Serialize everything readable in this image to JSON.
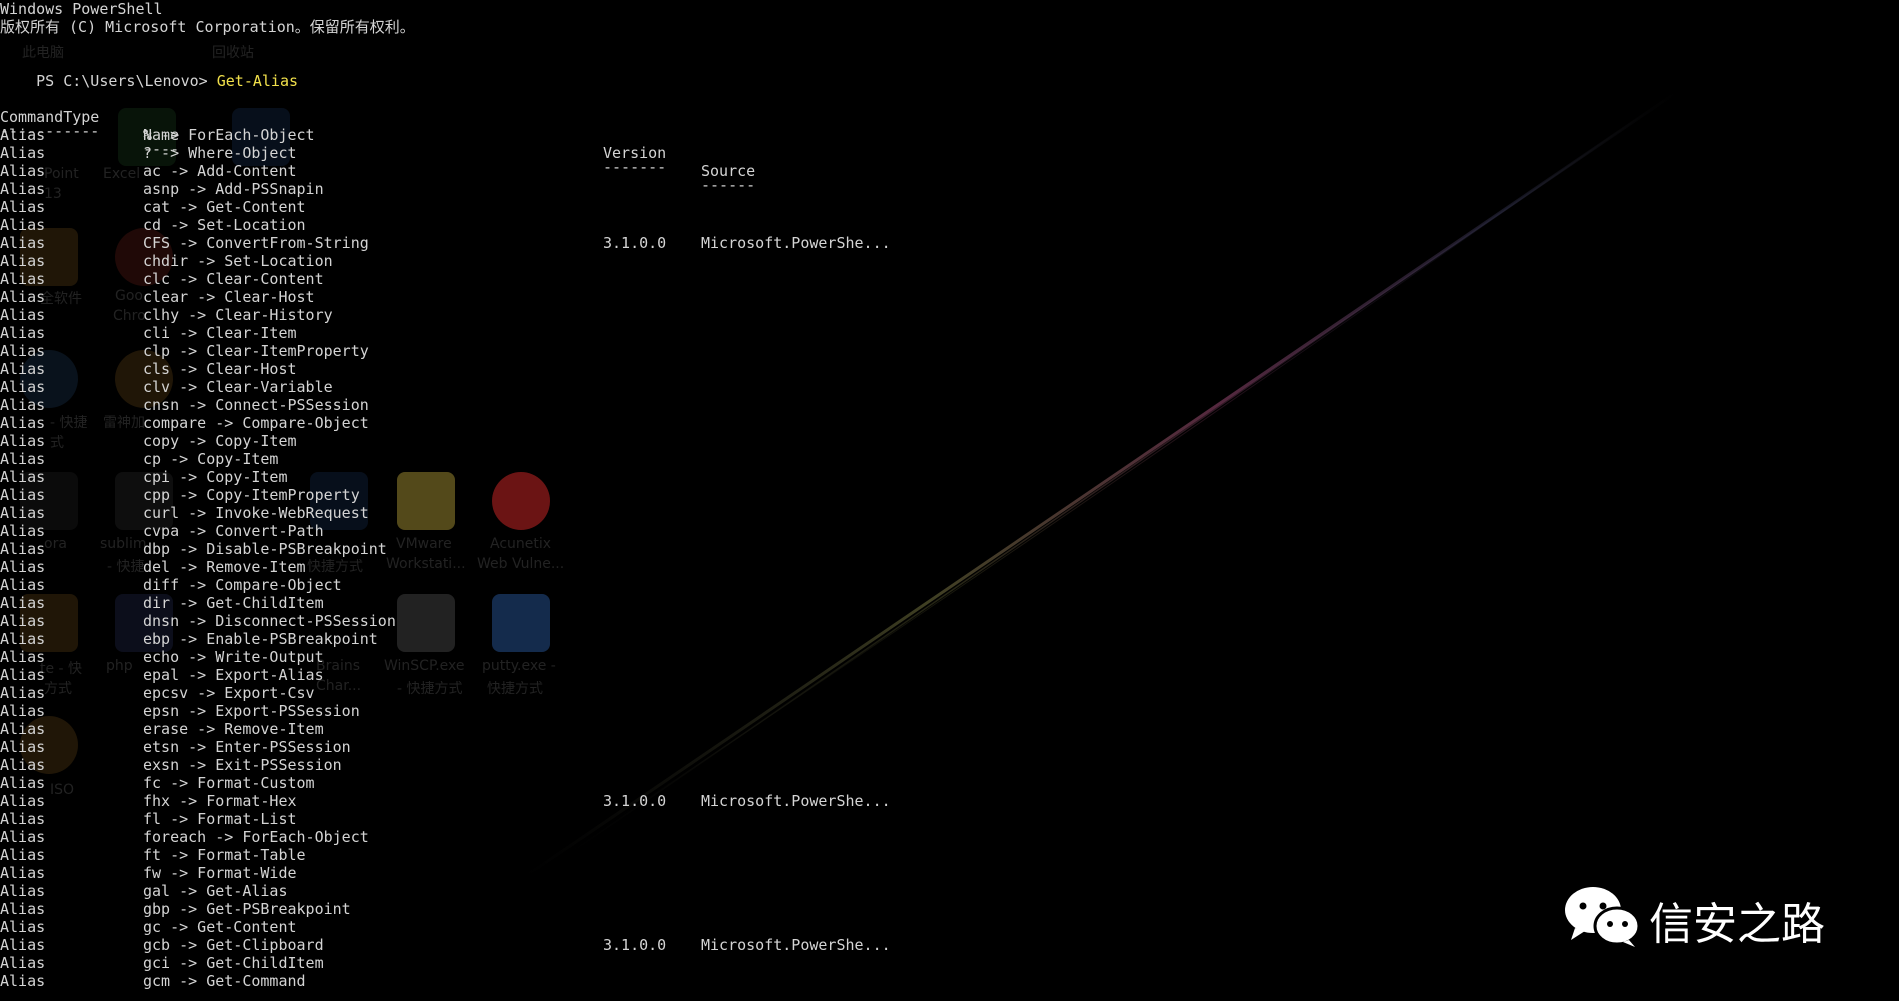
{
  "console": {
    "banner_title": "Windows PowerShell",
    "banner_copyright": "版权所有 (C) Microsoft Corporation。保留所有权利。",
    "prompt": "PS C:\\Users\\Lenovo> ",
    "command": "Get-Alias",
    "headers": {
      "command_type": "CommandType",
      "name": "Name",
      "version": "Version",
      "source": "Source"
    },
    "underlines": {
      "command_type": "-----------",
      "name": "----",
      "version": "-------",
      "source": "------"
    },
    "rows": [
      {
        "type": "Alias",
        "name": "% -> ForEach-Object",
        "version": "",
        "source": ""
      },
      {
        "type": "Alias",
        "name": "? -> Where-Object",
        "version": "",
        "source": ""
      },
      {
        "type": "Alias",
        "name": "ac -> Add-Content",
        "version": "",
        "source": ""
      },
      {
        "type": "Alias",
        "name": "asnp -> Add-PSSnapin",
        "version": "",
        "source": ""
      },
      {
        "type": "Alias",
        "name": "cat -> Get-Content",
        "version": "",
        "source": ""
      },
      {
        "type": "Alias",
        "name": "cd -> Set-Location",
        "version": "",
        "source": ""
      },
      {
        "type": "Alias",
        "name": "CFS -> ConvertFrom-String",
        "version": "3.1.0.0",
        "source": "Microsoft.PowerShe..."
      },
      {
        "type": "Alias",
        "name": "chdir -> Set-Location",
        "version": "",
        "source": ""
      },
      {
        "type": "Alias",
        "name": "clc -> Clear-Content",
        "version": "",
        "source": ""
      },
      {
        "type": "Alias",
        "name": "clear -> Clear-Host",
        "version": "",
        "source": ""
      },
      {
        "type": "Alias",
        "name": "clhy -> Clear-History",
        "version": "",
        "source": ""
      },
      {
        "type": "Alias",
        "name": "cli -> Clear-Item",
        "version": "",
        "source": ""
      },
      {
        "type": "Alias",
        "name": "clp -> Clear-ItemProperty",
        "version": "",
        "source": ""
      },
      {
        "type": "Alias",
        "name": "cls -> Clear-Host",
        "version": "",
        "source": ""
      },
      {
        "type": "Alias",
        "name": "clv -> Clear-Variable",
        "version": "",
        "source": ""
      },
      {
        "type": "Alias",
        "name": "cnsn -> Connect-PSSession",
        "version": "",
        "source": ""
      },
      {
        "type": "Alias",
        "name": "compare -> Compare-Object",
        "version": "",
        "source": ""
      },
      {
        "type": "Alias",
        "name": "copy -> Copy-Item",
        "version": "",
        "source": ""
      },
      {
        "type": "Alias",
        "name": "cp -> Copy-Item",
        "version": "",
        "source": ""
      },
      {
        "type": "Alias",
        "name": "cpi -> Copy-Item",
        "version": "",
        "source": ""
      },
      {
        "type": "Alias",
        "name": "cpp -> Copy-ItemProperty",
        "version": "",
        "source": ""
      },
      {
        "type": "Alias",
        "name": "curl -> Invoke-WebRequest",
        "version": "",
        "source": ""
      },
      {
        "type": "Alias",
        "name": "cvpa -> Convert-Path",
        "version": "",
        "source": ""
      },
      {
        "type": "Alias",
        "name": "dbp -> Disable-PSBreakpoint",
        "version": "",
        "source": ""
      },
      {
        "type": "Alias",
        "name": "del -> Remove-Item",
        "version": "",
        "source": ""
      },
      {
        "type": "Alias",
        "name": "diff -> Compare-Object",
        "version": "",
        "source": ""
      },
      {
        "type": "Alias",
        "name": "dir -> Get-ChildItem",
        "version": "",
        "source": ""
      },
      {
        "type": "Alias",
        "name": "dnsn -> Disconnect-PSSession",
        "version": "",
        "source": ""
      },
      {
        "type": "Alias",
        "name": "ebp -> Enable-PSBreakpoint",
        "version": "",
        "source": ""
      },
      {
        "type": "Alias",
        "name": "echo -> Write-Output",
        "version": "",
        "source": ""
      },
      {
        "type": "Alias",
        "name": "epal -> Export-Alias",
        "version": "",
        "source": ""
      },
      {
        "type": "Alias",
        "name": "epcsv -> Export-Csv",
        "version": "",
        "source": ""
      },
      {
        "type": "Alias",
        "name": "epsn -> Export-PSSession",
        "version": "",
        "source": ""
      },
      {
        "type": "Alias",
        "name": "erase -> Remove-Item",
        "version": "",
        "source": ""
      },
      {
        "type": "Alias",
        "name": "etsn -> Enter-PSSession",
        "version": "",
        "source": ""
      },
      {
        "type": "Alias",
        "name": "exsn -> Exit-PSSession",
        "version": "",
        "source": ""
      },
      {
        "type": "Alias",
        "name": "fc -> Format-Custom",
        "version": "",
        "source": ""
      },
      {
        "type": "Alias",
        "name": "fhx -> Format-Hex",
        "version": "3.1.0.0",
        "source": "Microsoft.PowerShe..."
      },
      {
        "type": "Alias",
        "name": "fl -> Format-List",
        "version": "",
        "source": ""
      },
      {
        "type": "Alias",
        "name": "foreach -> ForEach-Object",
        "version": "",
        "source": ""
      },
      {
        "type": "Alias",
        "name": "ft -> Format-Table",
        "version": "",
        "source": ""
      },
      {
        "type": "Alias",
        "name": "fw -> Format-Wide",
        "version": "",
        "source": ""
      },
      {
        "type": "Alias",
        "name": "gal -> Get-Alias",
        "version": "",
        "source": ""
      },
      {
        "type": "Alias",
        "name": "gbp -> Get-PSBreakpoint",
        "version": "",
        "source": ""
      },
      {
        "type": "Alias",
        "name": "gc -> Get-Content",
        "version": "",
        "source": ""
      },
      {
        "type": "Alias",
        "name": "gcb -> Get-Clipboard",
        "version": "3.1.0.0",
        "source": "Microsoft.PowerShe..."
      },
      {
        "type": "Alias",
        "name": "gci -> Get-ChildItem",
        "version": "",
        "source": ""
      },
      {
        "type": "Alias",
        "name": "gcm -> Get-Command",
        "version": "",
        "source": ""
      }
    ]
  },
  "desktop_ghosts": {
    "labels": [
      "此电脑",
      "回收站",
      "Point",
      "13",
      "Excel",
      "全软件",
      "Goo",
      "Chro",
      "- 快捷",
      "雷神加",
      "式",
      "ora",
      "sublim",
      "- 快捷",
      "快捷方式",
      "VMware",
      "Workstati...",
      "Acunetix",
      "Web Vulne...",
      "te - 快",
      "方式",
      "php",
      "Brains",
      "Char...",
      "WinSCP.exe",
      "- 快捷方式",
      "putty.exe -",
      "快捷方式",
      "ISO"
    ]
  },
  "watermark": {
    "text": "信安之路",
    "icon": "wechat-icon"
  },
  "colors": {
    "background": "#000000",
    "text": "#d4d4d4",
    "command": "#f2e14b"
  }
}
